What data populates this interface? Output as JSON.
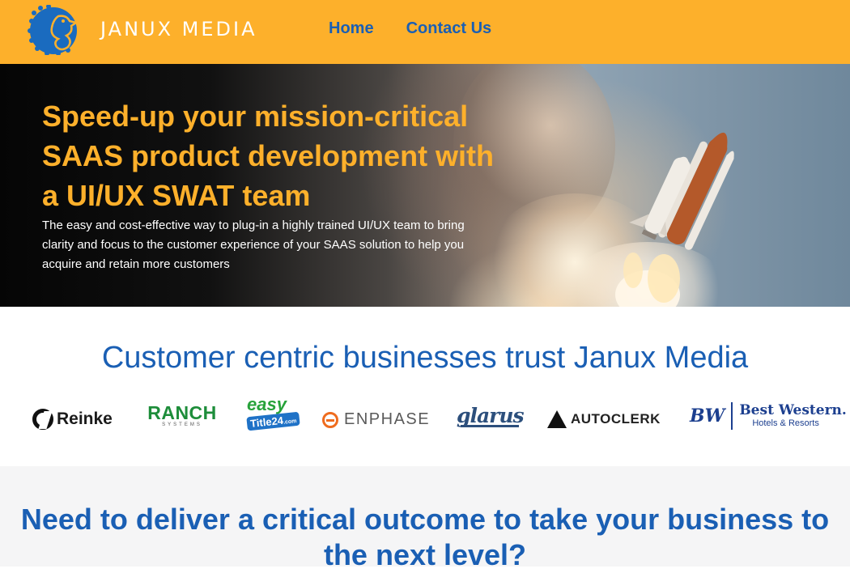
{
  "header": {
    "brand": "JANUX MEDIA",
    "logo_icon": "seahorse-logo-icon",
    "nav": [
      {
        "label": "Home"
      },
      {
        "label": "Contact Us"
      }
    ],
    "colors": {
      "background": "#fdb02b",
      "nav_text": "#1a5fb4",
      "brand_text": "#ffffff"
    }
  },
  "hero": {
    "title": "Speed-up your mission-critical SAAS product development with a UI/UX SWAT team",
    "subtitle": "The easy and cost-effective way to plug-in a highly trained UI/UX team to bring clarity and focus to the customer experience of your SAAS solution to help you acquire and retain more customers",
    "image": "space-shuttle-launch",
    "colors": {
      "title": "#fdb02b",
      "subtitle": "#ffffff"
    }
  },
  "trust": {
    "title": "Customer centric businesses trust Janux Media",
    "logos": {
      "reinke": "Reinke",
      "ranch": "RANCH",
      "ranch_sub": "SYSTEMS",
      "easy_top": "easy",
      "easy_bottom": "Title24",
      "easy_suffix": ".com",
      "enphase": "ENPHASE",
      "glarus": "glarus",
      "autoclerk": "AUTOCLERK",
      "bw_mark": "BW",
      "bw_name": "Best Western.",
      "bw_tagline": "Hotels & Resorts"
    }
  },
  "cta": {
    "title": "Need to deliver a critical outcome to take your business to the next level?"
  }
}
